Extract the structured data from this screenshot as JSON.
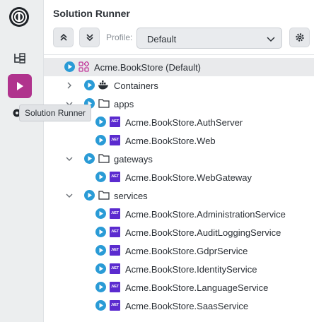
{
  "panel": {
    "title": "Solution Runner"
  },
  "toolbar": {
    "collapse_icon": "chevrons-up-icon",
    "expand_icon": "chevrons-down-icon",
    "profile_label": "Profile:",
    "profile_value": "Default",
    "settings_icon": "gear-icon"
  },
  "tooltip": {
    "text": "Solution Runner"
  },
  "tree": {
    "solution": "Acme.BookStore (Default)",
    "containers": "Containers",
    "apps": "apps",
    "apps_items": [
      "Acme.BookStore.AuthServer",
      "Acme.BookStore.Web"
    ],
    "gateways": "gateways",
    "gateways_items": [
      "Acme.BookStore.WebGateway"
    ],
    "services": "services",
    "services_items": [
      "Acme.BookStore.AdministrationService",
      "Acme.BookStore.AuditLoggingService",
      "Acme.BookStore.GdprService",
      "Acme.BookStore.IdentityService",
      "Acme.BookStore.LanguageService",
      "Acme.BookStore.SaasService"
    ],
    "net_badge": ".NET"
  },
  "colors": {
    "accent": "#b0338d",
    "play": "#2a9bd6",
    "net": "#5b2bcf"
  }
}
